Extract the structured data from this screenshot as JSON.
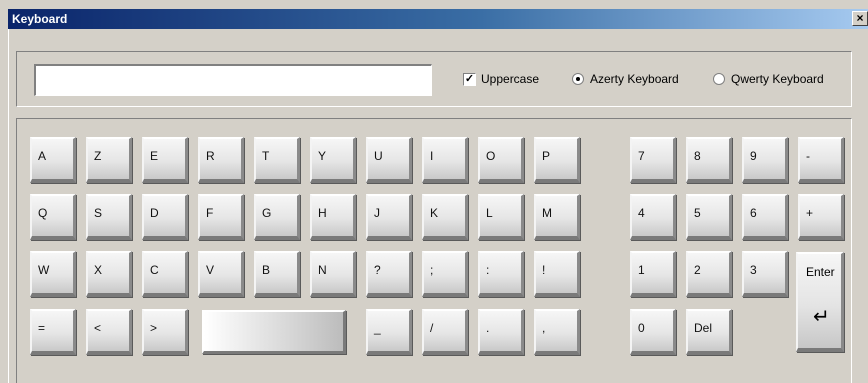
{
  "window": {
    "title": "Keyboard",
    "close_glyph": "×"
  },
  "input": {
    "value": ""
  },
  "options": {
    "uppercase": {
      "label": "Uppercase",
      "checked": true,
      "check_glyph": "✓"
    },
    "azerty": {
      "label": "Azerty Keyboard",
      "selected": true
    },
    "qwerty": {
      "label": "Qwerty Keyboard",
      "selected": false
    }
  },
  "keys": {
    "row1": [
      "A",
      "Z",
      "E",
      "R",
      "T",
      "Y",
      "U",
      "I",
      "O",
      "P"
    ],
    "row2": [
      "Q",
      "S",
      "D",
      "F",
      "G",
      "H",
      "J",
      "K",
      "L",
      "M"
    ],
    "row3": [
      "W",
      "X",
      "C",
      "V",
      "B",
      "N",
      "?",
      ";",
      ":",
      "!"
    ],
    "row4_left": [
      "=",
      "<",
      ">"
    ],
    "row4_right": [
      "_",
      "/",
      ".",
      ","
    ],
    "numpad_row1": [
      "7",
      "8",
      "9",
      "-"
    ],
    "numpad_row2": [
      "4",
      "5",
      "6",
      "+"
    ],
    "numpad_row3": [
      "1",
      "2",
      "3"
    ],
    "numpad_row4": [
      "0",
      "Del"
    ]
  },
  "enter": {
    "label": "Enter",
    "glyph": "↵"
  }
}
